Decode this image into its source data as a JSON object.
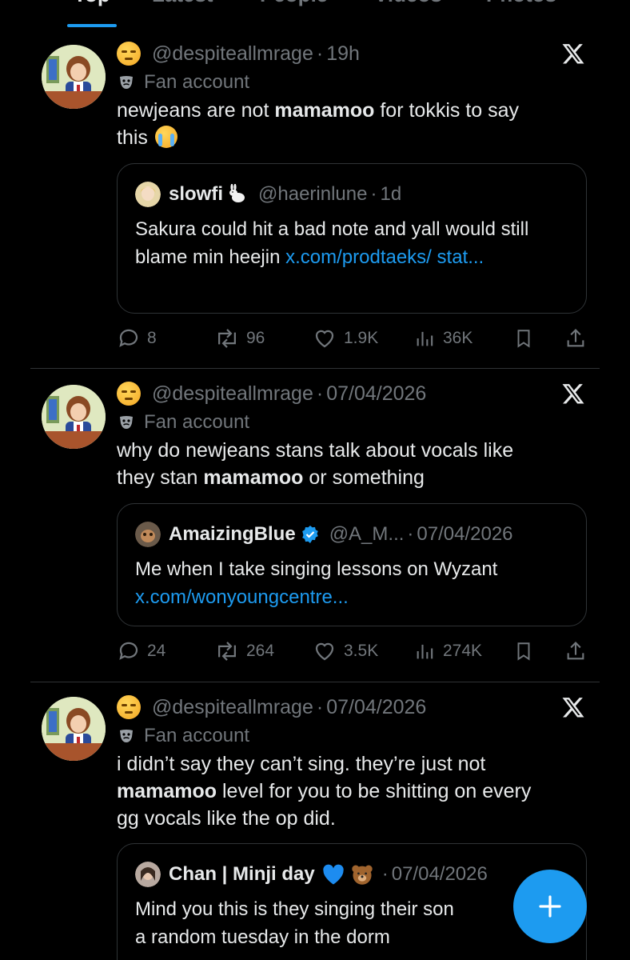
{
  "tabs": [
    {
      "label": "Top",
      "active": true
    },
    {
      "label": "Latest",
      "active": false
    },
    {
      "label": "People",
      "active": false
    },
    {
      "label": "Videos",
      "active": false
    },
    {
      "label": "Photos",
      "active": false
    }
  ],
  "tweets": [
    {
      "emoji": "unamused-face",
      "handle": "@despiteallmrage",
      "sep": "·",
      "time": "19h",
      "label": "Fan account",
      "text_parts": [
        "newjeans are not ",
        "mamamoo",
        " for tokkis to say",
        "this "
      ],
      "quote": {
        "name": "slowfi",
        "name_emoji": "rabbit",
        "handle": "@haerinlune",
        "sep": "·",
        "time": "1d",
        "text": "Sakura could hit a bad note and yall would still blame min heejin ",
        "link": "x.com/prodtaeks/ stat..."
      },
      "replies": "8",
      "retweets": "96",
      "likes": "1.9K",
      "views": "36K"
    },
    {
      "emoji": "unamused-face",
      "handle": "@despiteallmrage",
      "sep": "·",
      "time": "07/04/2026",
      "label": "Fan account",
      "text_parts": [
        "why do newjeans stans talk about vocals like",
        "they stan ",
        "mamamoo",
        " or something"
      ],
      "quote": {
        "name": "AmaizingBlue",
        "verified": true,
        "handle": "@A_M...",
        "sep": "·",
        "time": "07/04/2026",
        "text": "Me when I take singing lessons on Wyzant",
        "link": "x.com/wonyoungcentre..."
      },
      "replies": "24",
      "retweets": "264",
      "likes": "3.5K",
      "views": "274K"
    },
    {
      "emoji": "unamused-face",
      "handle": "@despiteallmrage",
      "sep": "·",
      "time": "07/04/2026",
      "label": "Fan account",
      "text_parts": [
        "i didn’t say they can’t sing. they’re just not",
        "mamamoo",
        " level for you to be shitting on every",
        "gg vocals like the op did."
      ],
      "quote": {
        "name": "Chan | Minji day",
        "name_emoji": "blue-heart bear",
        "sep": "·",
        "time": "07/04/2026",
        "text": "Mind you this is they singing their son",
        "text2": "a random tuesday in the dorm"
      }
    }
  ],
  "fab": {
    "icon": "plus-icon"
  },
  "colors": {
    "accent": "#1d9bf0",
    "muted": "#71767b",
    "text": "#e7e9ea",
    "border": "#2f3336"
  }
}
